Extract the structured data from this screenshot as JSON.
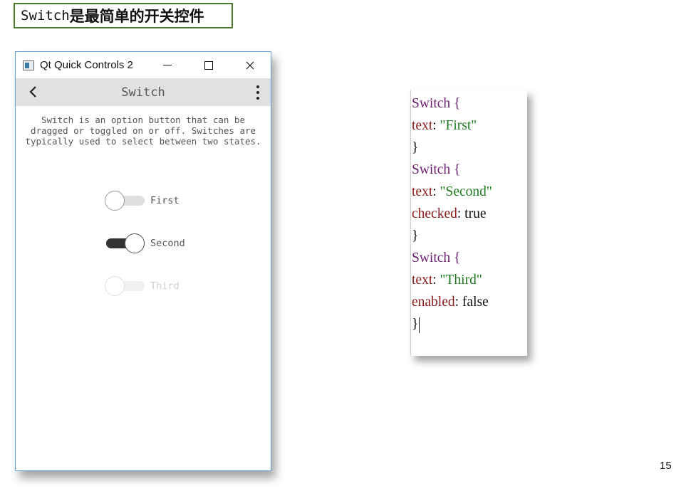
{
  "slide": {
    "title_mono": "Switch",
    "title_cn": "是最简单的开关控件",
    "page_number": "15"
  },
  "window": {
    "title": "Qt Quick Controls 2",
    "toolbar_title": "Switch",
    "description": "Switch is an option button that can be dragged or toggled on or off. Switches are typically used to select between two states.",
    "switches": [
      {
        "label": "First",
        "checked": false,
        "enabled": true
      },
      {
        "label": "Second",
        "checked": true,
        "enabled": true
      },
      {
        "label": "Third",
        "checked": false,
        "enabled": false
      }
    ]
  },
  "code": {
    "lines": [
      [
        {
          "t": "Switch",
          "c": "kw"
        },
        {
          "t": " {",
          "c": "kw"
        }
      ],
      [
        {
          "t": "text",
          "c": "prop"
        },
        {
          "t": ": ",
          "c": "plain"
        },
        {
          "t": "\"First\"",
          "c": "str"
        }
      ],
      [
        {
          "t": "}",
          "c": "plain"
        }
      ],
      [
        {
          "t": "Switch",
          "c": "kw"
        },
        {
          "t": " {",
          "c": "kw"
        }
      ],
      [
        {
          "t": "text",
          "c": "prop"
        },
        {
          "t": ": ",
          "c": "plain"
        },
        {
          "t": "\"Second\"",
          "c": "str"
        }
      ],
      [
        {
          "t": "checked",
          "c": "prop"
        },
        {
          "t": ": true",
          "c": "plain"
        }
      ],
      [
        {
          "t": "}",
          "c": "plain"
        }
      ],
      [
        {
          "t": "Switch",
          "c": "kw"
        },
        {
          "t": " {",
          "c": "kw"
        }
      ],
      [
        {
          "t": "text",
          "c": "prop"
        },
        {
          "t": ": ",
          "c": "plain"
        },
        {
          "t": "\"Third\"",
          "c": "str"
        }
      ],
      [
        {
          "t": "enabled",
          "c": "prop"
        },
        {
          "t": ": false",
          "c": "plain"
        }
      ],
      [
        {
          "t": "}",
          "c": "plain"
        }
      ]
    ]
  },
  "colors": {
    "title_border": "#4e7a2f",
    "keyword": "#6b1f6f",
    "property": "#8b1a1a",
    "string": "#1e7a1e",
    "switch_on_track": "#333333",
    "toolbar_bg": "#e1e1e1"
  },
  "icons": {
    "app": "qt-app-icon",
    "minimize": "minimize-icon",
    "maximize": "maximize-icon",
    "close": "close-icon",
    "back": "chevron-left-icon",
    "menu": "more-vertical-icon"
  }
}
